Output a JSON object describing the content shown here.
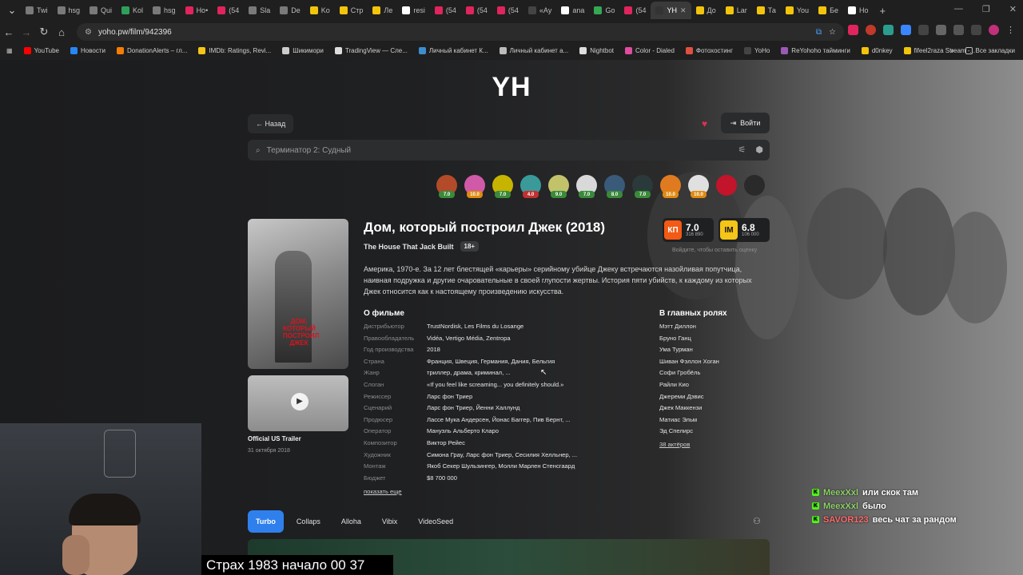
{
  "browser": {
    "tabs": [
      {
        "label": "Twi",
        "color": "#7a7a7a"
      },
      {
        "label": "hsg",
        "color": "#7a7a7a"
      },
      {
        "label": "Qui",
        "color": "#7a7a7a"
      },
      {
        "label": "Kol",
        "color": "#2fa05a"
      },
      {
        "label": "hsg",
        "color": "#7a7a7a"
      },
      {
        "label": "Ho•",
        "color": "#e0245e"
      },
      {
        "label": "(54",
        "color": "#e0245e"
      },
      {
        "label": "Sla",
        "color": "#7a7a7a"
      },
      {
        "label": "De",
        "color": "#7a7a7a"
      },
      {
        "label": "Ko",
        "color": "#f2c40c"
      },
      {
        "label": "Стр",
        "color": "#f2c40c"
      },
      {
        "label": "Ле",
        "color": "#f2c40c"
      },
      {
        "label": "resi",
        "color": "#ffffff"
      },
      {
        "label": "(54",
        "color": "#e0245e"
      },
      {
        "label": "(54",
        "color": "#e0245e"
      },
      {
        "label": "(54",
        "color": "#e0245e"
      },
      {
        "label": "«Aу",
        "color": "#444444"
      },
      {
        "label": "ana",
        "color": "#ffffff"
      },
      {
        "label": "Go",
        "color": "#34a853"
      },
      {
        "label": "(54",
        "color": "#e0245e"
      },
      {
        "label": "YH",
        "color": "#333333"
      },
      {
        "label": "До",
        "color": "#f2c40c"
      },
      {
        "label": "Lar",
        "color": "#f2c40c"
      },
      {
        "label": "Та",
        "color": "#f2c40c"
      },
      {
        "label": "You",
        "color": "#f2c40c"
      },
      {
        "label": "Бе",
        "color": "#f2c40c"
      },
      {
        "label": "Ho",
        "color": "#ffffff"
      }
    ],
    "url": "yoho.pw/film/942396",
    "bookmarks": [
      {
        "label": "YouTube",
        "color": "#ff0000"
      },
      {
        "label": "Новости",
        "color": "#2787f5"
      },
      {
        "label": "DonationAlerts – гл...",
        "color": "#f57d07"
      },
      {
        "label": "IMDb: Ratings, Revi...",
        "color": "#f5c518"
      },
      {
        "label": "Шикимори",
        "color": "#cccccc"
      },
      {
        "label": "TradingView — Сле...",
        "color": "#dddddd"
      },
      {
        "label": "Личный кабинет К...",
        "color": "#3b8ed0"
      },
      {
        "label": "Личный кабинет а...",
        "color": "#bbbbbb"
      },
      {
        "label": "Nightbot",
        "color": "#dddddd"
      },
      {
        "label": "Color - Dialed",
        "color": "#e04ca0"
      },
      {
        "label": "Фотохостинг",
        "color": "#e05040"
      },
      {
        "label": "YoHo",
        "color": "#444444"
      },
      {
        "label": "ReYohoho тайминги",
        "color": "#9b59b6"
      },
      {
        "label": "d0nkey",
        "color": "#f2c40c"
      },
      {
        "label": "fifeel2raza Stream -...",
        "color": "#f2c40c"
      }
    ],
    "all_bookmarks": "Все закладки"
  },
  "site": {
    "logo": "YH",
    "back_label": "← Назад",
    "login_label": "Войти",
    "search_value": "Терминатор 2: Судный"
  },
  "avatars": [
    {
      "score": "7.0",
      "color": "#b34a2a",
      "badge": "#3a8a3a"
    },
    {
      "score": "10.0",
      "color": "#d05aa8",
      "badge": "#e08a10"
    },
    {
      "score": "7.0",
      "color": "#c6b400",
      "badge": "#3a8a3a"
    },
    {
      "score": "4.0",
      "color": "#3a9a9a",
      "badge": "#c23030"
    },
    {
      "score": "9.0",
      "color": "#c2c26a",
      "badge": "#3a8a3a"
    },
    {
      "score": "7.0",
      "color": "#d9d9d9",
      "badge": "#3a8a3a"
    },
    {
      "score": "8.0",
      "color": "#3a5a7a",
      "badge": "#3a8a3a"
    },
    {
      "score": "7.0",
      "color": "#2a3a3a",
      "badge": "#3a8a3a"
    },
    {
      "score": "10.0",
      "color": "#e07a20",
      "badge": "#e08a10"
    },
    {
      "score": "10.0",
      "color": "#e0e0e0",
      "badge": "#e08a10"
    },
    {
      "score": "",
      "color": "#c2142a",
      "badge": "#c2142a"
    },
    {
      "score": "",
      "color": "#2a2a2a",
      "badge": "#2a2a2a"
    }
  ],
  "film": {
    "title": "Дом, который построил Джек (2018)",
    "original_title": "The House That Jack Built",
    "age": "18+",
    "kp_logo": "КП",
    "kp_rating": "7.0",
    "kp_votes": "316 890",
    "imdb_logo": "IM",
    "imdb_rating": "6.8",
    "imdb_votes": "106 000",
    "rate_hint": "Войдите, чтобы оставить оценку",
    "description": "Америка, 1970-е. За 12 лет блестящей «карьеры» серийному убийце Джеку встречаются назойливая попутчица, наивная подружка и другие очаровательные в своей глупости жертвы. История пяти убийств, к каждому из которых Джек относится как к настоящему произведению искусства.",
    "poster_text": "ДОМ, КОТОРЫЙ ПОСТРОИЛ ДЖЕК",
    "about_heading": "О фильме",
    "facts": [
      {
        "k": "Дистрибьютор",
        "v": "TrustNordisk, Les Films du Losange"
      },
      {
        "k": "Правообладатель",
        "v": "Vidéa, Vertigo Média, Zentropa"
      },
      {
        "k": "Год производства",
        "v": "2018"
      },
      {
        "k": "Страна",
        "v": "Франция, Швеция, Германия, Дания, Бельгия"
      },
      {
        "k": "Жанр",
        "v": "триллер, драма, криминал, ..."
      },
      {
        "k": "Слоган",
        "v": "«If you feel like screaming... you definitely should.»"
      },
      {
        "k": "Режиссер",
        "v": "Ларс фон Триер"
      },
      {
        "k": "Сценарий",
        "v": "Ларс фон Триер, Йенни Халлунд"
      },
      {
        "k": "Продюсер",
        "v": "Лассе Мука Андерсен, Йонас Баггер, Пив Бернт, ..."
      },
      {
        "k": "Оператор",
        "v": "Мануэль Альберто Кларо"
      },
      {
        "k": "Композитор",
        "v": "Виктор Рейес"
      },
      {
        "k": "Художник",
        "v": "Симона Грау, Ларс фон Триер, Сесилия Хелльнер, ..."
      },
      {
        "k": "Монтаж",
        "v": "Якоб Секер Шульзингер, Молли Марлен Стенсгаард"
      },
      {
        "k": "Бюджет",
        "v": "$8 700 000"
      }
    ],
    "show_more": "показать еще",
    "cast_heading": "В главных ролях",
    "cast": [
      "Мэтт Диллон",
      "Бруно Ганц",
      "Ума Турман",
      "Шиван Фэллон Хоган",
      "Софи Гробёль",
      "Райли Кио",
      "Джереми Дэвис",
      "Джек Маккензи",
      "Матиас Эльм",
      "Эд Спелирс"
    ],
    "cast_more": "38 актёров",
    "trailer_title": "Official US Trailer",
    "trailer_date": "31 октября 2018"
  },
  "players": [
    "Turbo",
    "Collaps",
    "Alloha",
    "Vibix",
    "VideoSeed"
  ],
  "stream": {
    "caption": "Страх 1983 начало 00 37",
    "chat": [
      {
        "user": "MeexXxl",
        "text": "или скок там",
        "red": false
      },
      {
        "user": "MeexXxl",
        "text": "было",
        "red": false
      },
      {
        "user": "SAVOR123",
        "text": "весь чат за рандом",
        "red": true
      }
    ]
  }
}
